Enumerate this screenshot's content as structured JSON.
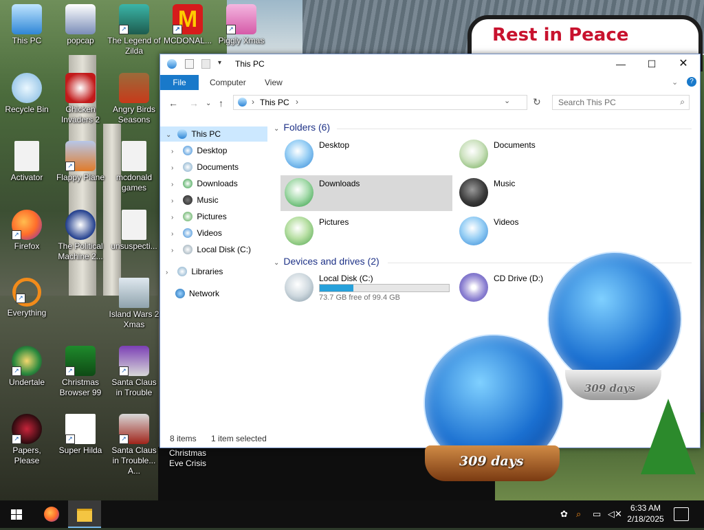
{
  "desktop": {
    "icons": [
      {
        "label": "This PC"
      },
      {
        "label": "popcap"
      },
      {
        "label": "The Legend of Zilda"
      },
      {
        "label": "MCDONAL..."
      },
      {
        "label": "Piggly Xmas"
      },
      {
        "label": "Recycle Bin"
      },
      {
        "label": "Chicken Invaders 2"
      },
      {
        "label": "Angry Birds Seasons"
      },
      {
        "label": "Activator"
      },
      {
        "label": "Flappy Plane"
      },
      {
        "label": "mcdonald games"
      },
      {
        "label": "Firefox"
      },
      {
        "label": "The Political Machine 2..."
      },
      {
        "label": "unsuspecti..."
      },
      {
        "label": "Everything"
      },
      {
        "label": "Island Wars 2 Xmas"
      },
      {
        "label": "Undertale"
      },
      {
        "label": "Christmas Browser 99"
      },
      {
        "label": "Santa Claus in Trouble"
      },
      {
        "label": "Papers, Please"
      },
      {
        "label": "Super Hilda"
      },
      {
        "label": "Santa Claus in Trouble... A..."
      },
      {
        "label": "Christmas Eve Crisis"
      }
    ],
    "wallpaper_sign": "Rest in Peace",
    "globe_days": "309 days"
  },
  "explorer": {
    "title": "This PC",
    "ribbon_tabs": [
      "File",
      "Computer",
      "View"
    ],
    "address": "This PC",
    "search_placeholder": "Search This PC",
    "nav": {
      "this_pc": "This PC",
      "children": [
        "Desktop",
        "Documents",
        "Downloads",
        "Music",
        "Pictures",
        "Videos",
        "Local Disk (C:)"
      ],
      "libraries": "Libraries",
      "network": "Network"
    },
    "folders_header": "Folders (6)",
    "folders": [
      "Desktop",
      "Documents",
      "Downloads",
      "Music",
      "Pictures",
      "Videos"
    ],
    "selected_folder": "Downloads",
    "drives_header": "Devices and drives (2)",
    "drives": [
      {
        "name": "Local Disk (C:)",
        "free_text": "73.7 GB free of 99.4 GB",
        "used_fraction": 0.26
      },
      {
        "name": "CD Drive (D:)"
      }
    ],
    "status": {
      "items": "8 items",
      "selected": "1 item selected"
    }
  },
  "taskbar": {
    "time": "6:33 AM",
    "date": "2/18/2025"
  },
  "colors": {
    "accent": "#1979ca",
    "selection": "#cce8ff",
    "header_text": "#1e3287",
    "drive_fill": "#26a0da"
  }
}
